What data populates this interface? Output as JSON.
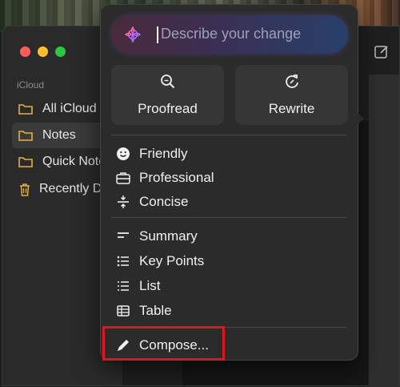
{
  "window": {
    "sidebar": {
      "section_label": "iCloud",
      "items": [
        {
          "label": "All iCloud",
          "icon": "folder-icon"
        },
        {
          "label": "Notes",
          "icon": "folder-icon",
          "selected": true
        },
        {
          "label": "Quick Notes",
          "icon": "folder-icon"
        },
        {
          "label": "Recently Deleted",
          "icon": "trash-icon"
        }
      ]
    }
  },
  "writing_tools": {
    "prompt_placeholder": "Describe your change",
    "primary_actions": [
      {
        "label": "Proofread",
        "icon": "proofread-icon"
      },
      {
        "label": "Rewrite",
        "icon": "rewrite-icon"
      }
    ],
    "tone_options": [
      {
        "label": "Friendly",
        "icon": "smiley-icon"
      },
      {
        "label": "Professional",
        "icon": "briefcase-icon"
      },
      {
        "label": "Concise",
        "icon": "concise-icon"
      }
    ],
    "format_options": [
      {
        "label": "Summary",
        "icon": "summary-icon"
      },
      {
        "label": "Key Points",
        "icon": "key-points-icon"
      },
      {
        "label": "List",
        "icon": "list-icon"
      },
      {
        "label": "Table",
        "icon": "table-icon"
      }
    ],
    "compose_label": "Compose...",
    "accent_color": "#7b5cff",
    "highlight_color": "#e0161a"
  }
}
